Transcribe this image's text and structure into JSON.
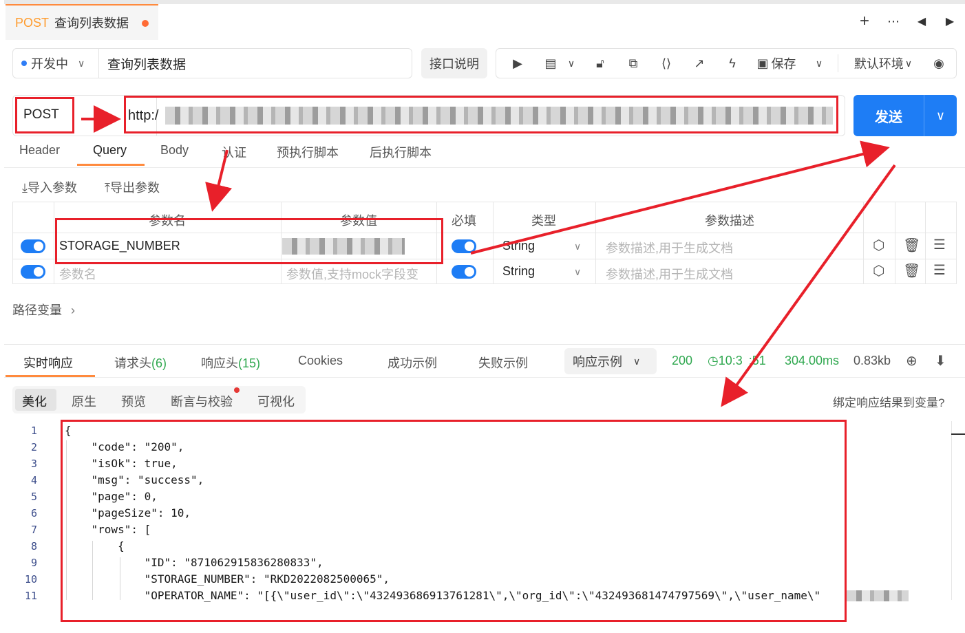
{
  "tab": {
    "method": "POST",
    "name": "查询列表数据"
  },
  "top_icons": [
    "plus-icon",
    "more-icon",
    "prev-icon",
    "next-icon"
  ],
  "status": {
    "label": "开发中"
  },
  "api_name": "查询列表数据",
  "doc_button": "接口说明",
  "toolbar": {
    "save_label": "保存",
    "env_label": "默认环境"
  },
  "request": {
    "method": "POST",
    "url_prefix": "http:/",
    "send_label": "发送"
  },
  "request_tabs": [
    "Header",
    "Query",
    "Body",
    "认证",
    "预执行脚本",
    "后执行脚本"
  ],
  "param_actions": {
    "import": "导入参数",
    "export": "导出参数"
  },
  "param_headers": {
    "name": "参数名",
    "value": "参数值",
    "required": "必填",
    "type": "类型",
    "desc": "参数描述"
  },
  "params": [
    {
      "name": "STORAGE_NUMBER",
      "value": "",
      "type": "String",
      "desc_placeholder": "参数描述,用于生成文档"
    },
    {
      "name_placeholder": "参数名",
      "value_placeholder": "参数值,支持mock字段变",
      "type": "String",
      "desc_placeholder": "参数描述,用于生成文档"
    }
  ],
  "path_variables": "路径变量",
  "response_tabs": {
    "realtime": "实时响应",
    "req_headers": "请求头",
    "req_headers_count": "(6)",
    "resp_headers": "响应头",
    "resp_headers_count": "(15)",
    "cookies": "Cookies",
    "success": "成功示例",
    "fail": "失败示例"
  },
  "example_dropdown": "响应示例",
  "response_meta": {
    "status": "200",
    "time": "10:3",
    "time_tail": ":51",
    "duration": "304.00ms",
    "size": "0.83kb"
  },
  "view_tabs": [
    "美化",
    "原生",
    "预览",
    "断言与校验",
    "可视化"
  ],
  "bind_link": "绑定响应结果到变量?",
  "code_lines": [
    "{",
    "    \"code\": \"200\",",
    "    \"isOk\": true,",
    "    \"msg\": \"success\",",
    "    \"page\": 0,",
    "    \"pageSize\": 10,",
    "    \"rows\": [",
    "        {",
    "            \"ID\": \"871062915836280833\",",
    "            \"STORAGE_NUMBER\": \"RKD2022082500065\",",
    "            \"OPERATOR_NAME\": \"[{\\\"user_id\\\":\\\"432493686913761281\\\",\\\"org_id\\\":\\\"432493681474797569\\\",\\\"user_name\\\""
  ],
  "line_numbers": [
    "1",
    "2",
    "3",
    "4",
    "5",
    "6",
    "7",
    "8",
    "9",
    "10",
    "11"
  ],
  "annotation_color": "#e8202a"
}
